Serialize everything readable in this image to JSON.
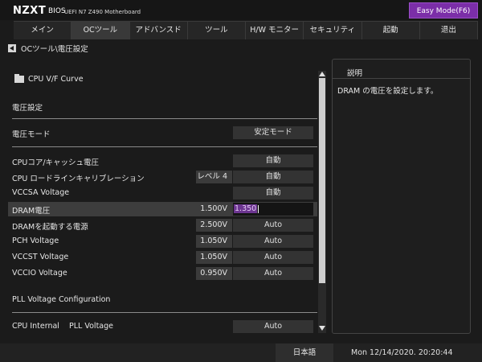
{
  "brand": {
    "logo": "NZXT",
    "bios": "BIOS",
    "model": "UEFI N7 Z490 Motherboard"
  },
  "easy_mode_label": "Easy Mode(F6)",
  "tabs": [
    {
      "label": "メイン"
    },
    {
      "label": "OCツール"
    },
    {
      "label": "アドバンスド"
    },
    {
      "label": "ツール"
    },
    {
      "label": "H/W モニター"
    },
    {
      "label": "セキュリティ"
    },
    {
      "label": "起動"
    },
    {
      "label": "退出"
    }
  ],
  "active_tab": "OCツール",
  "breadcrumb": "OCツール\\電圧設定",
  "cpu_vf_label": "CPU V/F Curve",
  "sections": {
    "voltage_settings": "電圧設定",
    "pll_config": "PLL Voltage Configuration"
  },
  "voltage_mode": {
    "label": "電圧モード",
    "value": "安定モード"
  },
  "rows": [
    {
      "label": "CPUコア/キャッシュ電圧",
      "current": "",
      "value": "自動"
    },
    {
      "label": "CPU ロードラインキャリブレーション",
      "current": "レベル 4",
      "value": "自動"
    },
    {
      "label": "VCCSA Voltage",
      "current": "",
      "value": "自動"
    },
    {
      "label": "DRAM電圧",
      "current": "1.500V",
      "value": "1.350"
    },
    {
      "label": "DRAMを起動する電源",
      "current": "2.500V",
      "value": "Auto"
    },
    {
      "label": "PCH Voltage",
      "current": "1.050V",
      "value": "Auto"
    },
    {
      "label": "VCCST Voltage",
      "current": "1.050V",
      "value": "Auto"
    },
    {
      "label": "VCCIO Voltage",
      "current": "0.950V",
      "value": "Auto"
    }
  ],
  "pll_row": {
    "label": "CPU Internal    PLL Voltage",
    "value": "Auto"
  },
  "help": {
    "title": "説明",
    "text": "DRAM の電圧を設定します。"
  },
  "status": {
    "language": "日本語",
    "datetime": "Mon 12/14/2020. 20:20:44"
  },
  "colors": {
    "accent": "#7b2ea8",
    "background": "#1b1b1b",
    "selected_row": "#3d3d3d"
  }
}
